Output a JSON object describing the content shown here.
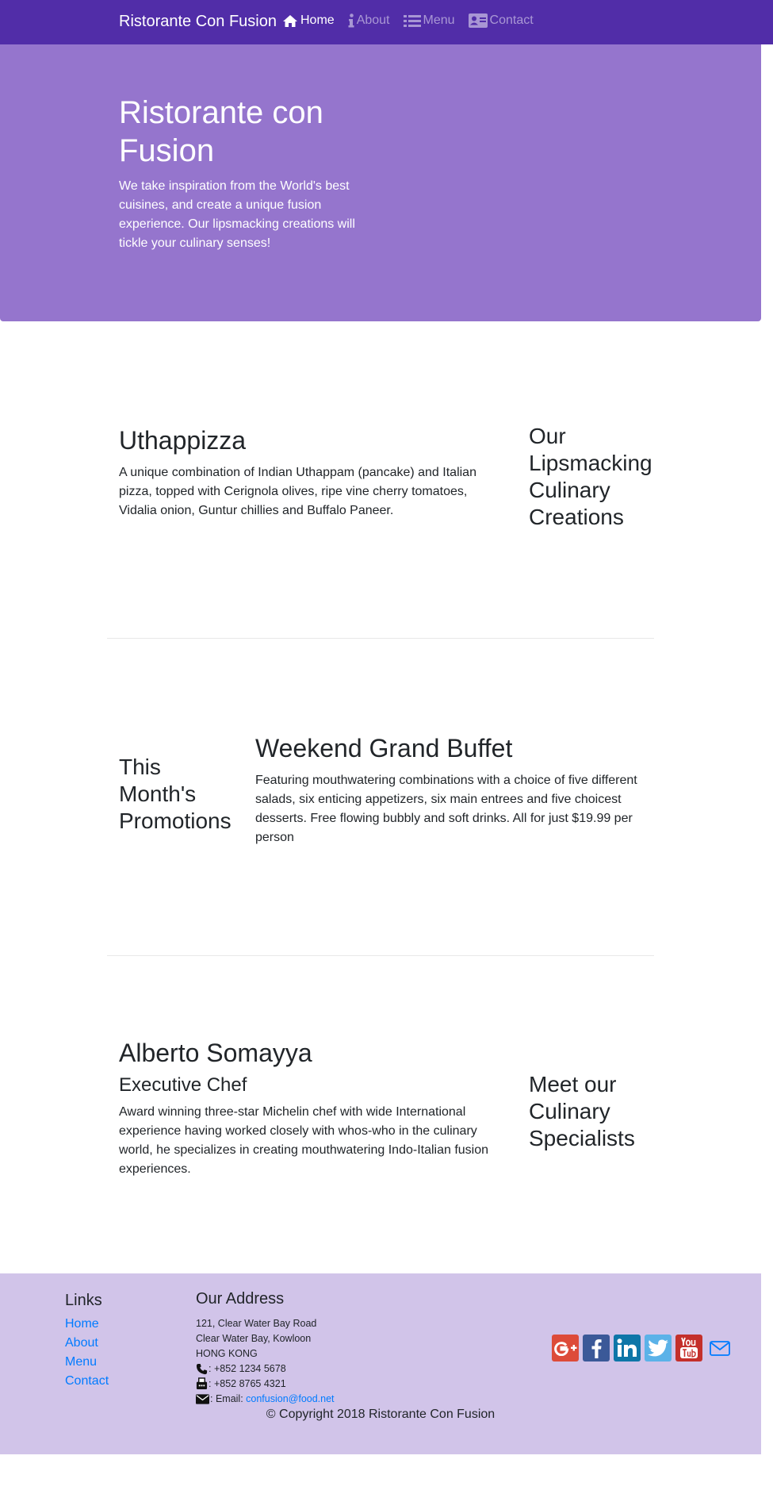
{
  "colors": {
    "navbar_bg": "#512da8",
    "jumbotron_bg": "#9575cd",
    "footer_bg": "#d1c4e9",
    "link": "#007bff"
  },
  "navbar": {
    "brand": "Ristorante Con Fusion",
    "items": [
      {
        "label": "Home",
        "icon": "home-icon",
        "active": true
      },
      {
        "label": "About",
        "icon": "info-icon",
        "active": false
      },
      {
        "label": "Menu",
        "icon": "list-icon",
        "active": false
      },
      {
        "label": "Contact",
        "icon": "address-card-icon",
        "active": false
      }
    ]
  },
  "jumbotron": {
    "title": "Ristorante con Fusion",
    "text": "We take inspiration from the World's best cuisines, and create a unique fusion experience. Our lipsmacking creations will tickle your culinary senses!"
  },
  "dish": {
    "title": "Uthappizza",
    "description": "A unique combination of Indian Uthappam (pancake) and Italian pizza, topped with Cerignola olives, ripe vine cherry tomatoes, Vidalia onion, Guntur chillies and Buffalo Paneer.",
    "side_heading": "Our Lipsmacking Culinary Creations"
  },
  "promotion": {
    "side_heading": "This Month's Promotions",
    "title": "Weekend Grand Buffet",
    "description": "Featuring mouthwatering combinations with a choice of five different salads, six enticing appetizers, six main entrees and five choicest desserts. Free flowing bubbly and soft drinks. All for just $19.99 per person"
  },
  "leader": {
    "name": "Alberto Somayya",
    "designation": "Executive Chef",
    "description": "Award winning three-star Michelin chef with wide International experience having worked closely with whos-who in the culinary world, he specializes in creating mouthwatering Indo-Italian fusion experiences.",
    "side_heading": "Meet our Culinary Specialists"
  },
  "footer": {
    "links_title": "Links",
    "links": [
      "Home",
      "About",
      "Menu",
      "Contact"
    ],
    "address_title": "Our Address",
    "address_lines": [
      "121, Clear Water Bay Road",
      "Clear Water Bay, Kowloon",
      "HONG KONG"
    ],
    "phone": ": +852 1234 5678",
    "fax": ": +852 8765 4321",
    "email_label": ": Email: ",
    "email": "confusion@food.net",
    "social": [
      "google-plus-icon",
      "facebook-icon",
      "linkedin-icon",
      "twitter-icon",
      "youtube-icon",
      "envelope-icon"
    ],
    "copyright": "© Copyright 2018 Ristorante Con Fusion"
  }
}
